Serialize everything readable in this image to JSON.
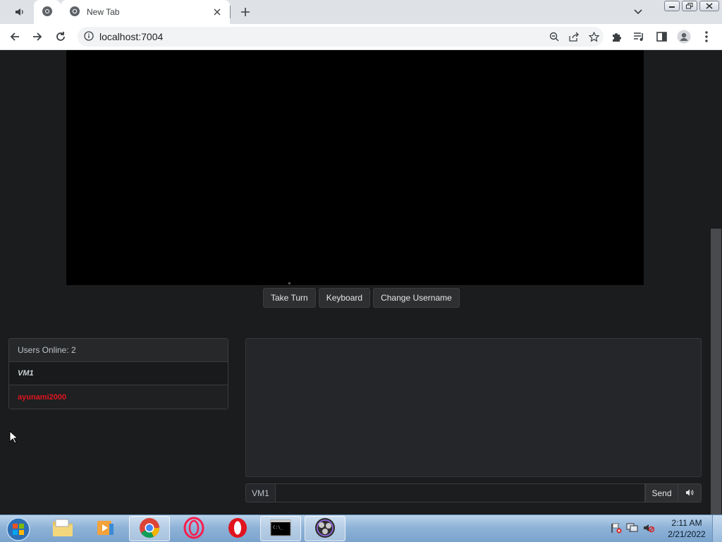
{
  "browser": {
    "tab_title": "New Tab",
    "url": "localhost:7004"
  },
  "vm": {
    "buttons": {
      "take_turn": "Take Turn",
      "keyboard": "Keyboard",
      "change_username": "Change Username"
    }
  },
  "users": {
    "header": "Users Online: 2",
    "list": [
      {
        "name": "VM1",
        "color": "#cfd3d6"
      },
      {
        "name": "ayunami2000",
        "color": "#e0141e"
      }
    ]
  },
  "chat": {
    "prefix": "VM1",
    "input_value": "",
    "send_label": "Send"
  },
  "taskbar": {
    "apps": [
      "file-explorer",
      "media-player",
      "chrome",
      "opera-gx",
      "opera",
      "command-prompt",
      "obs-studio"
    ],
    "clock_time": "2:11 AM",
    "clock_date": "2/21/2022"
  }
}
